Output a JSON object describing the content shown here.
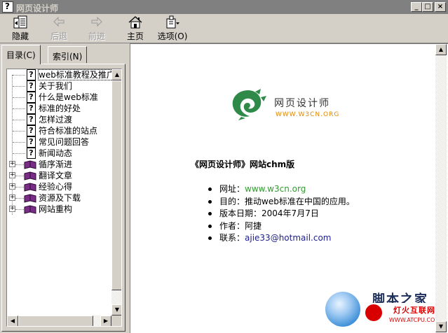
{
  "window": {
    "title": "网页设计师",
    "controls": {
      "minimize": "_",
      "maximize": "□",
      "close": "×"
    }
  },
  "toolbar": {
    "buttons": [
      {
        "label": "隐藏",
        "icon": "hide-icon",
        "enabled": true
      },
      {
        "label": "后退",
        "icon": "back-arrow-icon",
        "enabled": false
      },
      {
        "label": "前进",
        "icon": "forward-arrow-icon",
        "enabled": false
      },
      {
        "label": "主页",
        "icon": "home-icon",
        "enabled": true
      },
      {
        "label": "选项(O)",
        "icon": "options-icon",
        "enabled": true
      }
    ]
  },
  "tabs": [
    {
      "label": "目录(C)",
      "active": true
    },
    {
      "label": "索引(N)",
      "active": false
    }
  ],
  "tree": {
    "items": [
      {
        "label": "web标准教程及推广:我们",
        "type": "page",
        "selected": true
      },
      {
        "label": "关于我们",
        "type": "page"
      },
      {
        "label": "什么是web标准",
        "type": "page"
      },
      {
        "label": "标准的好处",
        "type": "page"
      },
      {
        "label": "怎样过渡",
        "type": "page"
      },
      {
        "label": "符合标准的站点",
        "type": "page"
      },
      {
        "label": "常见问题回答",
        "type": "page"
      },
      {
        "label": "新闻动态",
        "type": "page"
      },
      {
        "label": "循序渐进",
        "type": "book"
      },
      {
        "label": "翻译文章",
        "type": "book"
      },
      {
        "label": "经验心得",
        "type": "book"
      },
      {
        "label": "资源及下载",
        "type": "book"
      },
      {
        "label": "网站重构",
        "type": "book"
      }
    ],
    "expand_glyph": "+"
  },
  "content": {
    "logo_title": "网页设计师",
    "logo_url": "WWW.W3CN.ORG",
    "heading": "《网页设计师》网站chm版",
    "info": [
      {
        "label": "网址：",
        "value": "www.w3cn.org",
        "style": "green"
      },
      {
        "label": "目的：",
        "value": "推动web标准在中国的应用。",
        "style": "plain"
      },
      {
        "label": "版本日期：",
        "value": "2004年7月7日",
        "style": "plain"
      },
      {
        "label": "作者：",
        "value": "阿捷",
        "style": "plain"
      },
      {
        "label": "联系：",
        "value": "ajie33@hotmail.com",
        "style": "link"
      }
    ],
    "watermark": {
      "cn_text": "脚本之家",
      "badge_text": "灯火互联网",
      "badge_url": "WWW.ATCPU.COM"
    }
  },
  "colors": {
    "window_bg": "#d4d0c8",
    "title_bg": "#808080",
    "link_green": "#339933",
    "logo_green": "#2f8a4a",
    "logo_orange": "#e08800"
  }
}
